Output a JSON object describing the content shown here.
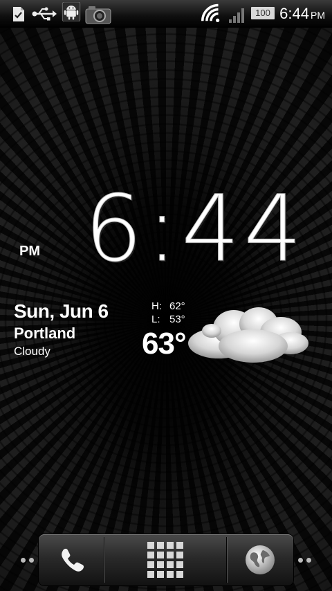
{
  "status_bar": {
    "icons": [
      "task-icon",
      "usb-icon",
      "android-debug-icon",
      "camera-icon",
      "wifi-icon",
      "signal-icon"
    ],
    "battery_level": "100",
    "time": "6:44",
    "ampm": "PM"
  },
  "clock": {
    "time": "6:44",
    "ampm": "PM"
  },
  "weather": {
    "date": "Sun, Jun 6",
    "city": "Portland",
    "condition": "Cloudy",
    "high_label": "H:",
    "high": "62°",
    "low_label": "L:",
    "low": "53°",
    "current_temp": "63°",
    "icon": "cloud-icon"
  },
  "dock": {
    "items": [
      "phone-icon",
      "app-drawer-icon",
      "browser-globe-icon"
    ]
  }
}
